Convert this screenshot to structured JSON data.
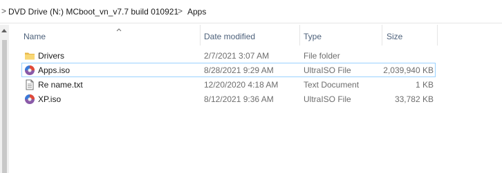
{
  "breadcrumb": {
    "items": [
      "DVD Drive (N:) MCboot_vn_v7.7 build 010921",
      "Apps"
    ],
    "separator": ">"
  },
  "columns": {
    "name": "Name",
    "date": "Date modified",
    "type": "Type",
    "size": "Size"
  },
  "files": [
    {
      "name": "Drivers",
      "date": "2/7/2021 3:07 AM",
      "type": "File folder",
      "size": "",
      "icon": "folder-icon",
      "selected": false
    },
    {
      "name": "Apps.iso",
      "date": "8/28/2021 9:29 AM",
      "type": "UltraISO File",
      "size": "2,039,940 KB",
      "icon": "ultraiso-disc-icon",
      "selected": true
    },
    {
      "name": "Re name.txt",
      "date": "12/20/2020 4:18 AM",
      "type": "Text Document",
      "size": "1 KB",
      "icon": "text-document-icon",
      "selected": false
    },
    {
      "name": "XP.iso",
      "date": "8/12/2021 9:36 AM",
      "type": "UltraISO File",
      "size": "33,782 KB",
      "icon": "ultraiso-disc-icon",
      "selected": false
    }
  ],
  "colors": {
    "selection_border": "#99d1ff",
    "header_text": "#4c607a",
    "folder": "#f8d775"
  }
}
